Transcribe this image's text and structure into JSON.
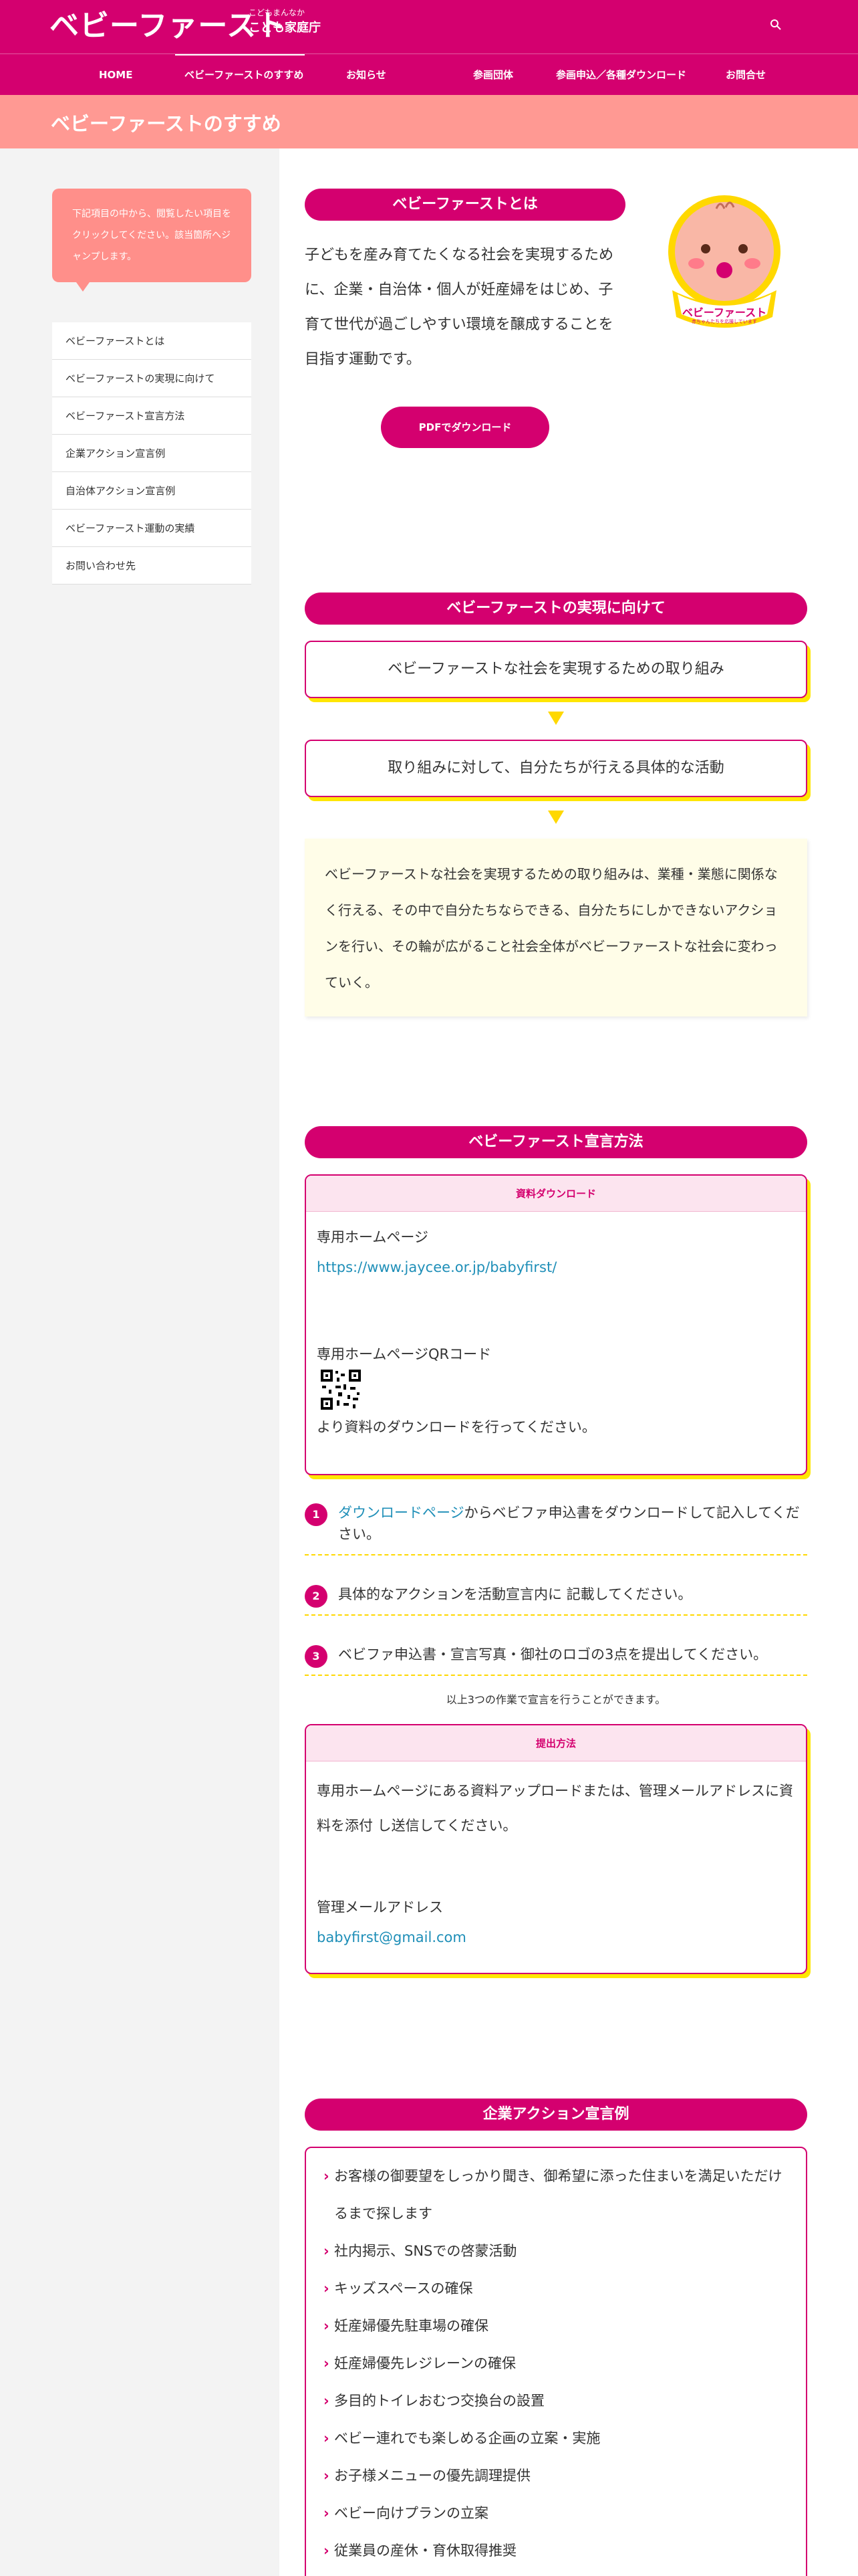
{
  "header": {
    "logo_main": "ベビーファースト",
    "logo_small": "こどもまんなか",
    "logo_big": "こども家庭庁",
    "search_icon": "search-icon"
  },
  "nav": {
    "items": [
      {
        "label": "HOME"
      },
      {
        "label": "ベビーファーストのすすめ"
      },
      {
        "label": "お知らせ"
      },
      {
        "label": "参画団体"
      },
      {
        "label": "参画申込／各種ダウンロード"
      },
      {
        "label": "お問合せ"
      }
    ]
  },
  "page_title": "ベビーファーストのすすめ",
  "sidebar": {
    "note": "下記項目の中から、閲覧したい項目をクリックしてください。該当箇所へジャンプします。",
    "items": [
      {
        "label": "ベビーファーストとは"
      },
      {
        "label": "ベビーファーストの実現に向けて"
      },
      {
        "label": "ベビーファースト宣言方法"
      },
      {
        "label": "企業アクション宣言例"
      },
      {
        "label": "自治体アクション宣言例"
      },
      {
        "label": "ベビーファースト運動の実績"
      },
      {
        "label": "お問い合わせ先"
      }
    ]
  },
  "about": {
    "heading": "ベビーファーストとは",
    "text": "子どもを産み育てたくなる社会を実現するために、企業・自治体・個人が妊産婦をはじめ、子育て世代が過ごしやすい環境を醸成することを目指す運動です。",
    "pdf_button": "PDFでダウンロード",
    "mascot_label": "ベビーファースト",
    "mascot_sub": "赤ちゃんたちを応援しています"
  },
  "realize": {
    "heading": "ベビーファーストの実現に向けて",
    "box1": "ベビーファーストな社会を実現するための取り組み",
    "box2": "取り組みに対して、自分たちが行える具体的な活動",
    "description": "ベビーファーストな社会を実現するための取り組みは、業種・業態に関係なく行える、その中で自分たちならできる、自分たちにしかできないアクションを行い、その輪が広がること社会全体がベビーファーストな社会に変わっていく。"
  },
  "declare": {
    "heading": "ベビーファースト宣言方法",
    "download_box": {
      "title": "資料ダウンロード",
      "hp_label": "専用ホームページ",
      "url": "https://www.jaycee.or.jp/babyfirst/",
      "qr_label": "専用ホームページQRコード",
      "after_qr": "より資料のダウンロードを行ってください。"
    },
    "steps": [
      {
        "num": "1",
        "link": "ダウンロードページ",
        "text": "からベビファ申込書をダウンロードして記入してください。"
      },
      {
        "num": "2",
        "link": "",
        "text": "具体的なアクションを活動宣言内に 記載してください。"
      },
      {
        "num": "3",
        "link": "",
        "text": "ベビファ申込書・宣言写真・御社のロゴの3点を提出してください。"
      }
    ],
    "steps_note": "以上3つの作業で宣言を行うことができます。",
    "submit_box": {
      "title": "提出方法",
      "text": "専用ホームページにある資料アップロードまたは、管理メールアドレスに資料を添付 し送信してください。",
      "mail_label": "管理メールアドレス",
      "mail": "babyfirst@gmail.com"
    }
  },
  "corporate": {
    "heading": "企業アクション宣言例",
    "items": [
      "お客様の御要望をしっかり聞き、御希望に添った住まいを満足いただけるまで探します",
      "社内掲示、SNSでの啓蒙活動",
      "キッズスペースの確保",
      "妊産婦優先駐車場の確保",
      "妊産婦優先レジレーンの確保",
      "多目的トイレおむつ交換台の設置",
      "ベビー連れでも楽しめる企画の立案・実施",
      "お子様メニューの優先調理提供",
      "ベビー向けプランの立案",
      "従業員の産休・育休取得推奨"
    ]
  },
  "colors": {
    "brand": "#d4006f",
    "salmon": "#ff9993",
    "accent_yellow": "#ffe600"
  }
}
